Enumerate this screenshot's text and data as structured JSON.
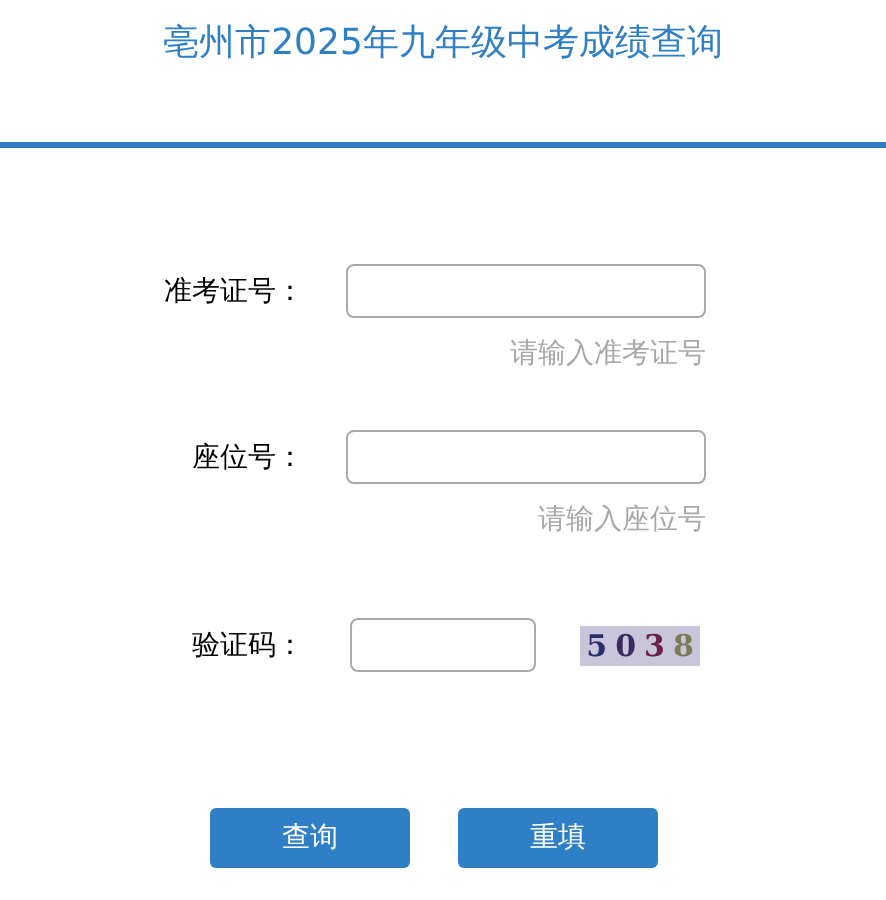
{
  "title": "亳州市2025年九年级中考成绩查询",
  "fields": [
    {
      "kind": "text",
      "label": "准考证号：",
      "hint": "请输入准考证号"
    },
    {
      "kind": "text",
      "label": "座位号：",
      "hint": "请输入座位号"
    },
    {
      "kind": "captcha",
      "label": "验证码：",
      "captcha": "5038"
    }
  ],
  "buttons": [
    "查询",
    "重填"
  ]
}
